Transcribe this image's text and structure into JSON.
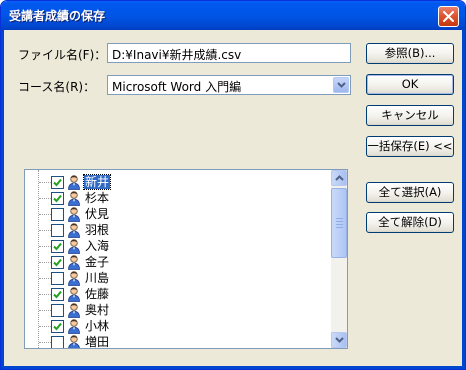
{
  "window": {
    "title": "受講者成績の保存"
  },
  "file_name": {
    "label": "ファイル名(F)：",
    "value": "D:¥Inavi¥新井成績.csv"
  },
  "course_name": {
    "label": "コース名(R)：",
    "value": "Microsoft Word 入門編"
  },
  "buttons": {
    "browse": "参照(B)...",
    "ok": "OK",
    "cancel": "キャンセル",
    "batch_save": "一括保存(E) <<",
    "select_all": "全て選択(A)",
    "deselect_all": "全て解除(D)"
  },
  "students": [
    {
      "name": "新井",
      "checked": true,
      "selected": true
    },
    {
      "name": "杉本",
      "checked": true,
      "selected": false
    },
    {
      "name": "伏見",
      "checked": false,
      "selected": false
    },
    {
      "name": "羽根",
      "checked": false,
      "selected": false
    },
    {
      "name": "入海",
      "checked": true,
      "selected": false
    },
    {
      "name": "金子",
      "checked": true,
      "selected": false
    },
    {
      "name": "川島",
      "checked": false,
      "selected": false
    },
    {
      "name": "佐藤",
      "checked": true,
      "selected": false
    },
    {
      "name": "奥村",
      "checked": false,
      "selected": false
    },
    {
      "name": "小林",
      "checked": true,
      "selected": false
    },
    {
      "name": "増田",
      "checked": false,
      "selected": false
    }
  ],
  "colors": {
    "title_blue": "#0055e5",
    "check_green": "#21a121",
    "selection": "#316ac5"
  }
}
